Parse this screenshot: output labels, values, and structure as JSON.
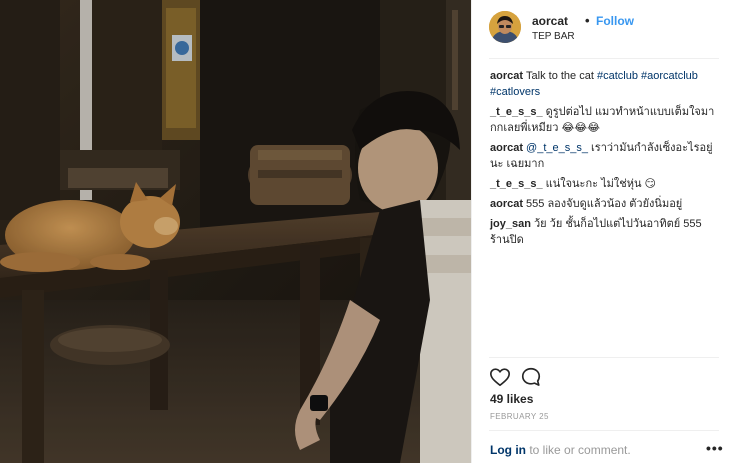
{
  "post": {
    "photo_icon": "cat-on-table-photo",
    "author": "aorcat",
    "separator": "•",
    "follow_label": "Follow",
    "location": "TEP BAR",
    "caption": {
      "user": "aorcat",
      "text": "Talk to the cat",
      "tags": [
        "#catclub",
        "#aorcatclub",
        "#catlovers"
      ]
    },
    "comments": [
      {
        "user": "_t_e_s_s_",
        "text": "ดูรูปต่อไป แมวทำหน้าแบบเต็มใจมากกเลยพี่เหมียว 😂😂😂"
      },
      {
        "user": "aorcat",
        "mention": "@_t_e_s_s_",
        "text": "เราว่ามันกำลังเซ็งอะไรอยู่นะ เฉยมาก"
      },
      {
        "user": "_t_e_s_s_",
        "text": "แน่ใจนะกะ ไม่ใช่หุ่น 😏"
      },
      {
        "user": "aorcat",
        "text": "555 ลองจับดูแล้วน้อง ตัวยังนิ่มอยู่"
      },
      {
        "user": "joy_san",
        "text": "ว้ย ว้ย ชั้นก็อไปแต่ไปวันอาทิตย์ 555 ร้านปิด"
      }
    ],
    "likes": "49 likes",
    "date": "FEBRUARY 25",
    "footer": {
      "login_label": "Log in",
      "rest": "to like or comment."
    },
    "more_label": "•••",
    "icons": {
      "like": "heart-icon",
      "comment": "comment-icon"
    }
  }
}
